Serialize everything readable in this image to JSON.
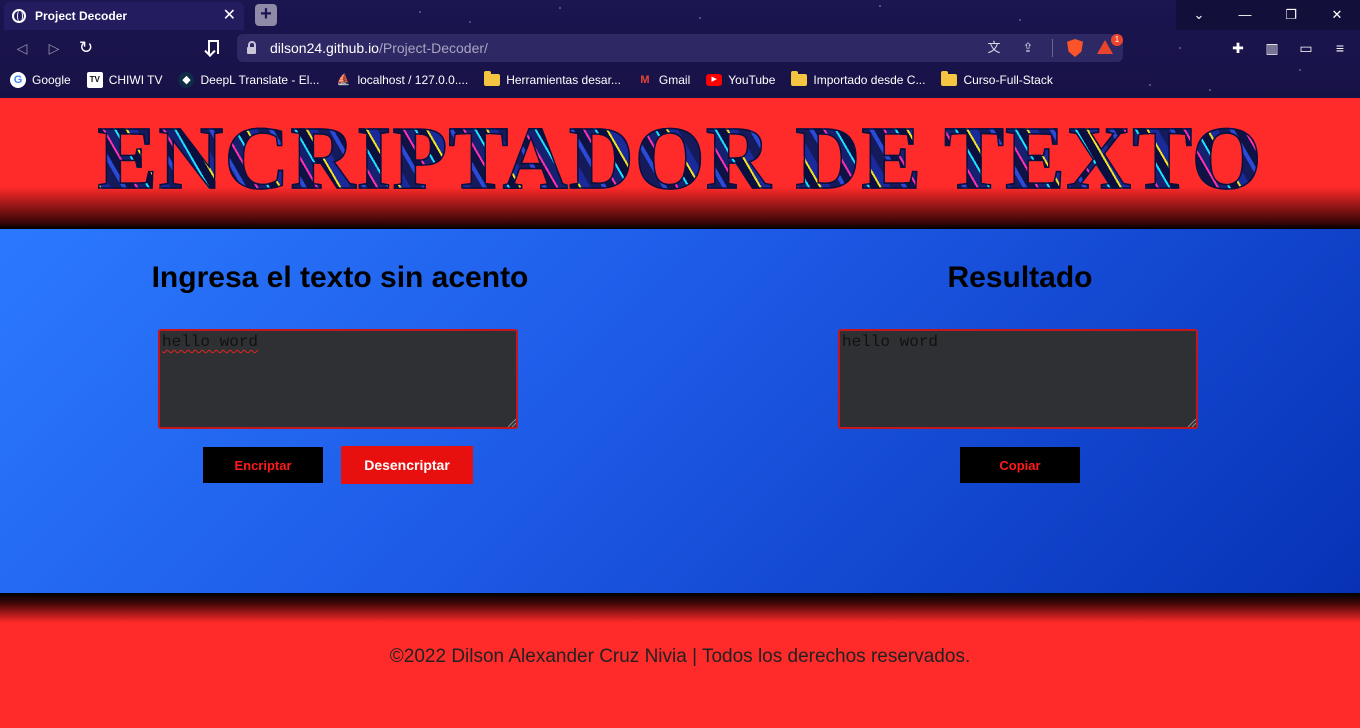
{
  "browser": {
    "tab_title": "Project Decoder",
    "tab_close": "✕",
    "new_tab": "+",
    "url_host": "dilson24.github.io",
    "url_path": "/Project-Decoder/",
    "rewards_badge": "1",
    "window_controls": {
      "tabsearch": "⌄",
      "minimize": "—",
      "restore": "❐",
      "close": "✕"
    },
    "bookmarks": [
      {
        "label": "Google",
        "icon": "G"
      },
      {
        "label": "CHIWI TV",
        "icon": "TV"
      },
      {
        "label": "DeepL Translate - El...",
        "icon": "◆"
      },
      {
        "label": "localhost / 127.0.0....",
        "icon": "⛵"
      },
      {
        "label": "Herramientas desar...",
        "icon": ""
      },
      {
        "label": "Gmail",
        "icon": "M"
      },
      {
        "label": "YouTube",
        "icon": "▶"
      },
      {
        "label": "Importado desde C...",
        "icon": ""
      },
      {
        "label": "Curso-Full-Stack",
        "icon": ""
      }
    ]
  },
  "page": {
    "title": "ENCRIPTADOR DE TEXTO",
    "input_heading": "Ingresa el texto sin acento",
    "input_value": "hello word",
    "result_heading": "Resultado",
    "result_value": "hello word",
    "encrypt_label": "Encriptar",
    "decrypt_label": "Desencriptar",
    "copy_label": "Copiar",
    "footer": "©2022 Dilson Alexander Cruz Nivia | Todos los derechos reservados."
  },
  "colors": {
    "header_red": "#ff2a2a",
    "main_blue_start": "#2b79ff",
    "main_blue_end": "#0732b6",
    "button_dark": "#000000",
    "button_red": "#e8100e",
    "textarea_bg": "#2e3033",
    "textarea_border": "#c4161c"
  }
}
